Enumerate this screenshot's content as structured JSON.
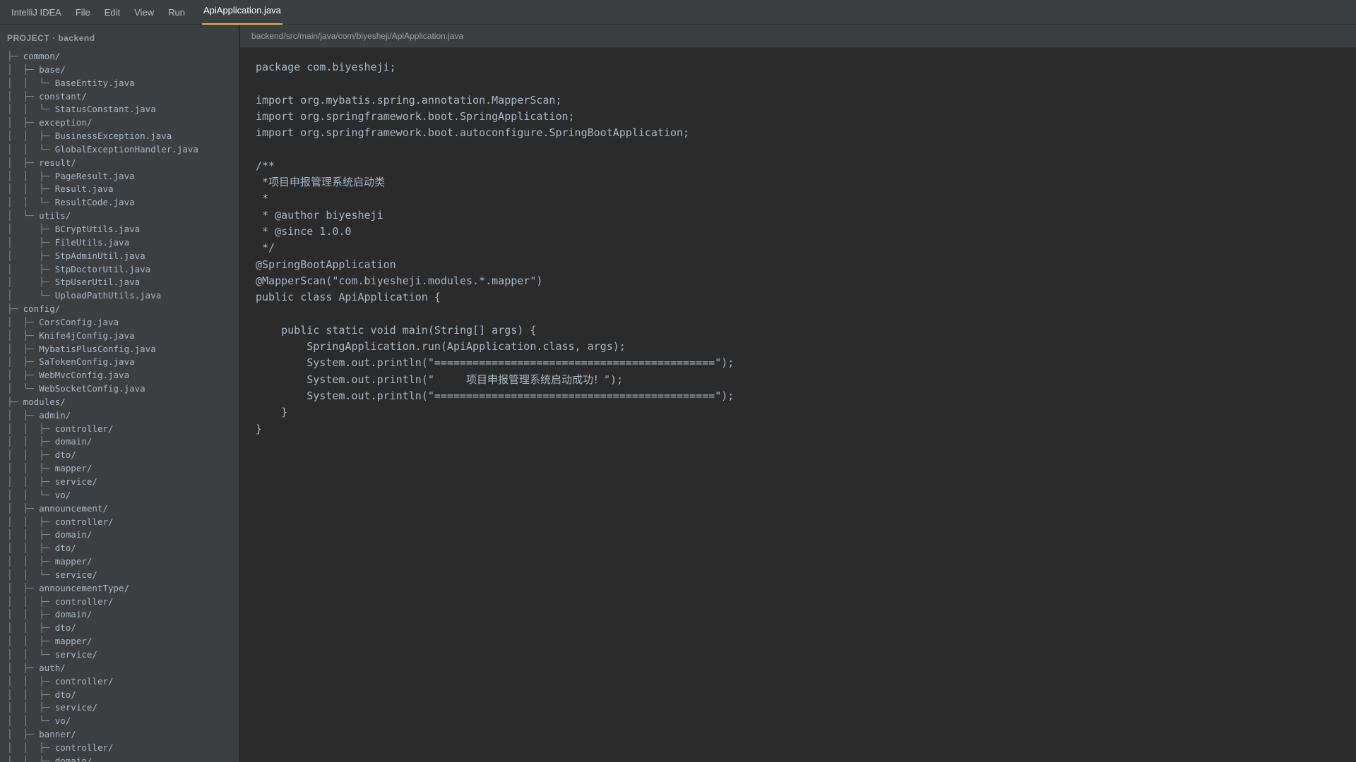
{
  "menubar": {
    "app_name": "IntelliJ IDEA",
    "items": [
      "File",
      "Edit",
      "View",
      "Run"
    ],
    "active_tab": "ApiApplication.java"
  },
  "sidebar": {
    "title": "PROJECT · backend",
    "tree": [
      {
        "prefix": "├─ ",
        "name": "common/"
      },
      {
        "prefix": "│  ├─ ",
        "name": "base/"
      },
      {
        "prefix": "│  │  └─ ",
        "name": "BaseEntity.java"
      },
      {
        "prefix": "│  ├─ ",
        "name": "constant/"
      },
      {
        "prefix": "│  │  └─ ",
        "name": "StatusConstant.java"
      },
      {
        "prefix": "│  ├─ ",
        "name": "exception/"
      },
      {
        "prefix": "│  │  ├─ ",
        "name": "BusinessException.java"
      },
      {
        "prefix": "│  │  └─ ",
        "name": "GlobalExceptionHandler.java"
      },
      {
        "prefix": "│  ├─ ",
        "name": "result/"
      },
      {
        "prefix": "│  │  ├─ ",
        "name": "PageResult.java"
      },
      {
        "prefix": "│  │  ├─ ",
        "name": "Result.java"
      },
      {
        "prefix": "│  │  └─ ",
        "name": "ResultCode.java"
      },
      {
        "prefix": "│  └─ ",
        "name": "utils/"
      },
      {
        "prefix": "│     ├─ ",
        "name": "BCryptUtils.java"
      },
      {
        "prefix": "│     ├─ ",
        "name": "FileUtils.java"
      },
      {
        "prefix": "│     ├─ ",
        "name": "StpAdminUtil.java"
      },
      {
        "prefix": "│     ├─ ",
        "name": "StpDoctorUtil.java"
      },
      {
        "prefix": "│     ├─ ",
        "name": "StpUserUtil.java"
      },
      {
        "prefix": "│     └─ ",
        "name": "UploadPathUtils.java"
      },
      {
        "prefix": "├─ ",
        "name": "config/"
      },
      {
        "prefix": "│  ├─ ",
        "name": "CorsConfig.java"
      },
      {
        "prefix": "│  ├─ ",
        "name": "Knife4jConfig.java"
      },
      {
        "prefix": "│  ├─ ",
        "name": "MybatisPlusConfig.java"
      },
      {
        "prefix": "│  ├─ ",
        "name": "SaTokenConfig.java"
      },
      {
        "prefix": "│  ├─ ",
        "name": "WebMvcConfig.java"
      },
      {
        "prefix": "│  └─ ",
        "name": "WebSocketConfig.java"
      },
      {
        "prefix": "├─ ",
        "name": "modules/"
      },
      {
        "prefix": "│  ├─ ",
        "name": "admin/"
      },
      {
        "prefix": "│  │  ├─ ",
        "name": "controller/"
      },
      {
        "prefix": "│  │  ├─ ",
        "name": "domain/"
      },
      {
        "prefix": "│  │  ├─ ",
        "name": "dto/"
      },
      {
        "prefix": "│  │  ├─ ",
        "name": "mapper/"
      },
      {
        "prefix": "│  │  ├─ ",
        "name": "service/"
      },
      {
        "prefix": "│  │  └─ ",
        "name": "vo/"
      },
      {
        "prefix": "│  ├─ ",
        "name": "announcement/"
      },
      {
        "prefix": "│  │  ├─ ",
        "name": "controller/"
      },
      {
        "prefix": "│  │  ├─ ",
        "name": "domain/"
      },
      {
        "prefix": "│  │  ├─ ",
        "name": "dto/"
      },
      {
        "prefix": "│  │  ├─ ",
        "name": "mapper/"
      },
      {
        "prefix": "│  │  └─ ",
        "name": "service/"
      },
      {
        "prefix": "│  ├─ ",
        "name": "announcementType/"
      },
      {
        "prefix": "│  │  ├─ ",
        "name": "controller/"
      },
      {
        "prefix": "│  │  ├─ ",
        "name": "domain/"
      },
      {
        "prefix": "│  │  ├─ ",
        "name": "dto/"
      },
      {
        "prefix": "│  │  ├─ ",
        "name": "mapper/"
      },
      {
        "prefix": "│  │  └─ ",
        "name": "service/"
      },
      {
        "prefix": "│  ├─ ",
        "name": "auth/"
      },
      {
        "prefix": "│  │  ├─ ",
        "name": "controller/"
      },
      {
        "prefix": "│  │  ├─ ",
        "name": "dto/"
      },
      {
        "prefix": "│  │  ├─ ",
        "name": "service/"
      },
      {
        "prefix": "│  │  └─ ",
        "name": "vo/"
      },
      {
        "prefix": "│  ├─ ",
        "name": "banner/"
      },
      {
        "prefix": "│  │  ├─ ",
        "name": "controller/"
      },
      {
        "prefix": "│  │  ├─ ",
        "name": "domain/"
      }
    ]
  },
  "editor": {
    "path": "backend/src/main/java/com/biyesheji/ApiApplication.java",
    "lines": [
      "package com.biyesheji;",
      "",
      "import org.mybatis.spring.annotation.MapperScan;",
      "import org.springframework.boot.SpringApplication;",
      "import org.springframework.boot.autoconfigure.SpringBootApplication;",
      "",
      "/**",
      " *项目申报管理系统启动类",
      " *",
      " * @author biyesheji",
      " * @since 1.0.0",
      " */",
      "@SpringBootApplication",
      "@MapperScan(\"com.biyesheji.modules.*.mapper\")",
      "public class ApiApplication {",
      "",
      "    public static void main(String[] args) {",
      "        SpringApplication.run(ApiApplication.class, args);",
      "        System.out.println(\"============================================\");",
      "        System.out.println(\"     项目申报管理系统启动成功！\");",
      "        System.out.println(\"============================================\");",
      "    }",
      "}"
    ]
  }
}
